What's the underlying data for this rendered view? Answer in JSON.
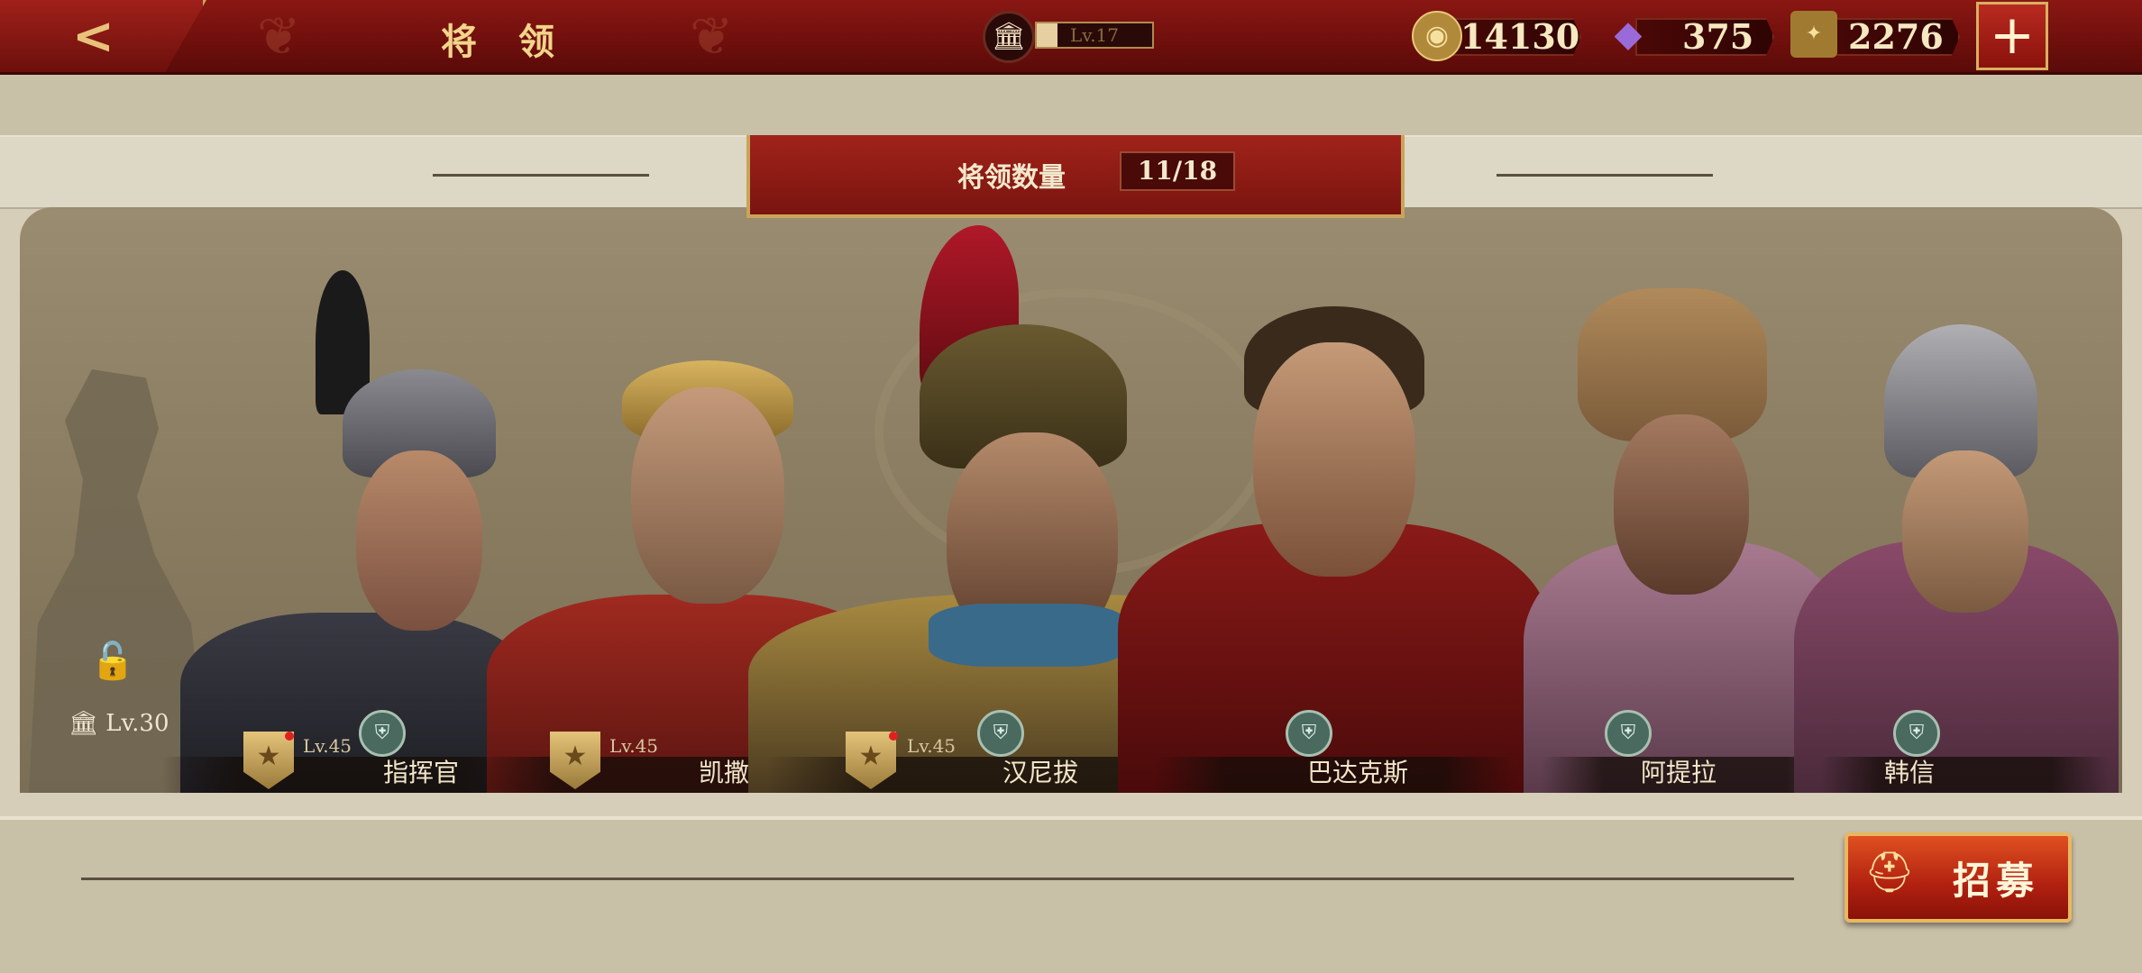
{
  "header": {
    "title": "将 领",
    "level": "Lv.17",
    "level_progress": 0.18,
    "resources": [
      {
        "icon": "gold-coin-icon",
        "value": "14130"
      },
      {
        "icon": "purple-gem-icon",
        "value": "375"
      },
      {
        "icon": "spqr-eagle-icon",
        "value": "2276"
      }
    ],
    "plus_label": "+"
  },
  "roster": {
    "count_label": "将领数量",
    "count_value": "11/18",
    "locked_level": "Lv.30"
  },
  "generals": [
    {
      "name": "指挥官",
      "level": "Lv.45",
      "new": true
    },
    {
      "name": "凯撒",
      "level": "Lv.45",
      "new": false
    },
    {
      "name": "汉尼拔",
      "level": "Lv.45",
      "new": true
    },
    {
      "name": "巴达克斯"
    },
    {
      "name": "阿提拉"
    },
    {
      "name": "韩信"
    }
  ],
  "actions": {
    "recruit_label": "招募"
  },
  "colors": {
    "accent_red": "#8a1713",
    "gold": "#c9a45a",
    "parchment": "#d6ceb8"
  }
}
